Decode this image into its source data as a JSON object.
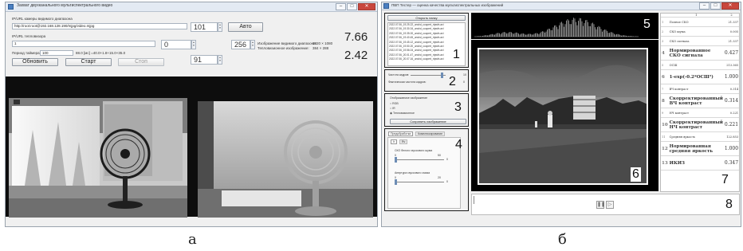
{
  "window_a": {
    "title": "Захват двухканального мультиспектрального видео",
    "visible_label": "IP/URL камеры видимого диапазона",
    "visible_url": "http://root:root@192.168.128.190/mjpg/video.mjpg",
    "thermal_label": "IP/URL тепловизора",
    "thermal_value": "1",
    "timer_label": "Период таймера:",
    "timer_value": "100",
    "timing_text": "88.0 [мс] =40.0+1.8+15.0+35.0",
    "spin1": "101",
    "spin2": "0",
    "spin3": "256",
    "spin4": "91",
    "auto_button": "Авто",
    "refresh_button": "Обновить",
    "start_button": "Старт",
    "stop_button": "Стоп",
    "info_line1": "Изображение видимого диапазона:",
    "info_line1_val": "1920 × 1080",
    "info_line2": "Тепловизионное изображение:",
    "info_line2_val": "384 × 288",
    "fps1": "7.66",
    "fps2": "2.42"
  },
  "window_b": {
    "title": "ПВП Тестер — оценка качества мультиспектральных изображений",
    "open_button": "Открыть папку",
    "files": [
      "2022.07.06_19.25.22_unshd_coopert_rtpwfn.avi",
      "2022.07.06_19.30.34_unshd_coopert_rtpwfn.avi",
      "2022.07.06_19.35.00_unshd_coopert_rtpwfn.avi",
      "2022.07.06_19.40.45_unshd_coopert_rtpwfn.avi",
      "2022.07.06_19.45.12_unshd_coopert_rtpwfn.avi",
      "2022.07.06_19.50.20_unshd_coopert_rtpwfn.avi",
      "2022.07.06_19.56.04_unshd_coopert_rtpwfn.avi",
      "2022.07.06_20.01.47_unshd_coopert_rtpwfn.avi",
      "2022.07.06_20.07.16_unshd_coopert_rtpwfn.avi"
    ],
    "freq_label": "Частота кадров:",
    "freq_value": "10",
    "freq_label2": "Фактическая частота кадров:",
    "freq_value2": "0",
    "display_label": "Отображаемое изображение",
    "radio_options": [
      "RGB",
      "IR",
      "Тепловизионное"
    ],
    "save_button": "Сохранить изображение",
    "tabs": [
      "Предобработка",
      "Комплексирование"
    ],
    "subtabs": [
      "Ir",
      "Rv"
    ],
    "slider1_label": "СКО белого гауссового шума",
    "slider1_min": "0",
    "slider1_max": "50",
    "slider1_value": "0",
    "slider2_label": "Апертура гауссового смаза",
    "slider2_min": "0",
    "slider2_max": "20",
    "slider2_value": "0",
    "table_header": [
      "1",
      "2"
    ],
    "metrics": [
      {
        "idx": "1",
        "name": "Полное СКО",
        "val": "21.337",
        "big": false
      },
      {
        "idx": "2",
        "name": "СКО шума",
        "val": "0.005",
        "big": false
      },
      {
        "idx": "3",
        "name": "СКО сигнала",
        "val": "21.337",
        "big": false
      },
      {
        "idx": "4",
        "name": "Нормированное СКО сигнала",
        "val": "0.427",
        "big": true
      },
      {
        "idx": "5",
        "name": "ОСШ",
        "val": "213.365",
        "big": false
      },
      {
        "idx": "6",
        "name": "1-exp(-0.2*ОСШ²)",
        "val": "1.000",
        "big": true
      },
      {
        "idx": "7",
        "name": "ВЧ контраст",
        "val": "0.314",
        "big": false
      },
      {
        "idx": "8",
        "name": "Скорректированный ВЧ контраст",
        "val": "0.314",
        "big": true
      },
      {
        "idx": "9",
        "name": "НЧ контраст",
        "val": "0.221",
        "big": false
      },
      {
        "idx": "10",
        "name": "Скорректированный НЧ контраст",
        "val": "0.221",
        "big": true
      },
      {
        "idx": "11",
        "name": "Средняя яркость",
        "val": "122.853",
        "big": false
      },
      {
        "idx": "12",
        "name": "Нормированная средняя яркость",
        "val": "1.000",
        "big": true
      },
      {
        "idx": "13",
        "name": "ИКИЗ",
        "val": "0.347",
        "big": true
      }
    ],
    "panel_numbers": [
      "1",
      "2",
      "3",
      "4",
      "5",
      "6",
      "7",
      "8"
    ]
  },
  "captions": {
    "left": "а",
    "right": "б"
  }
}
